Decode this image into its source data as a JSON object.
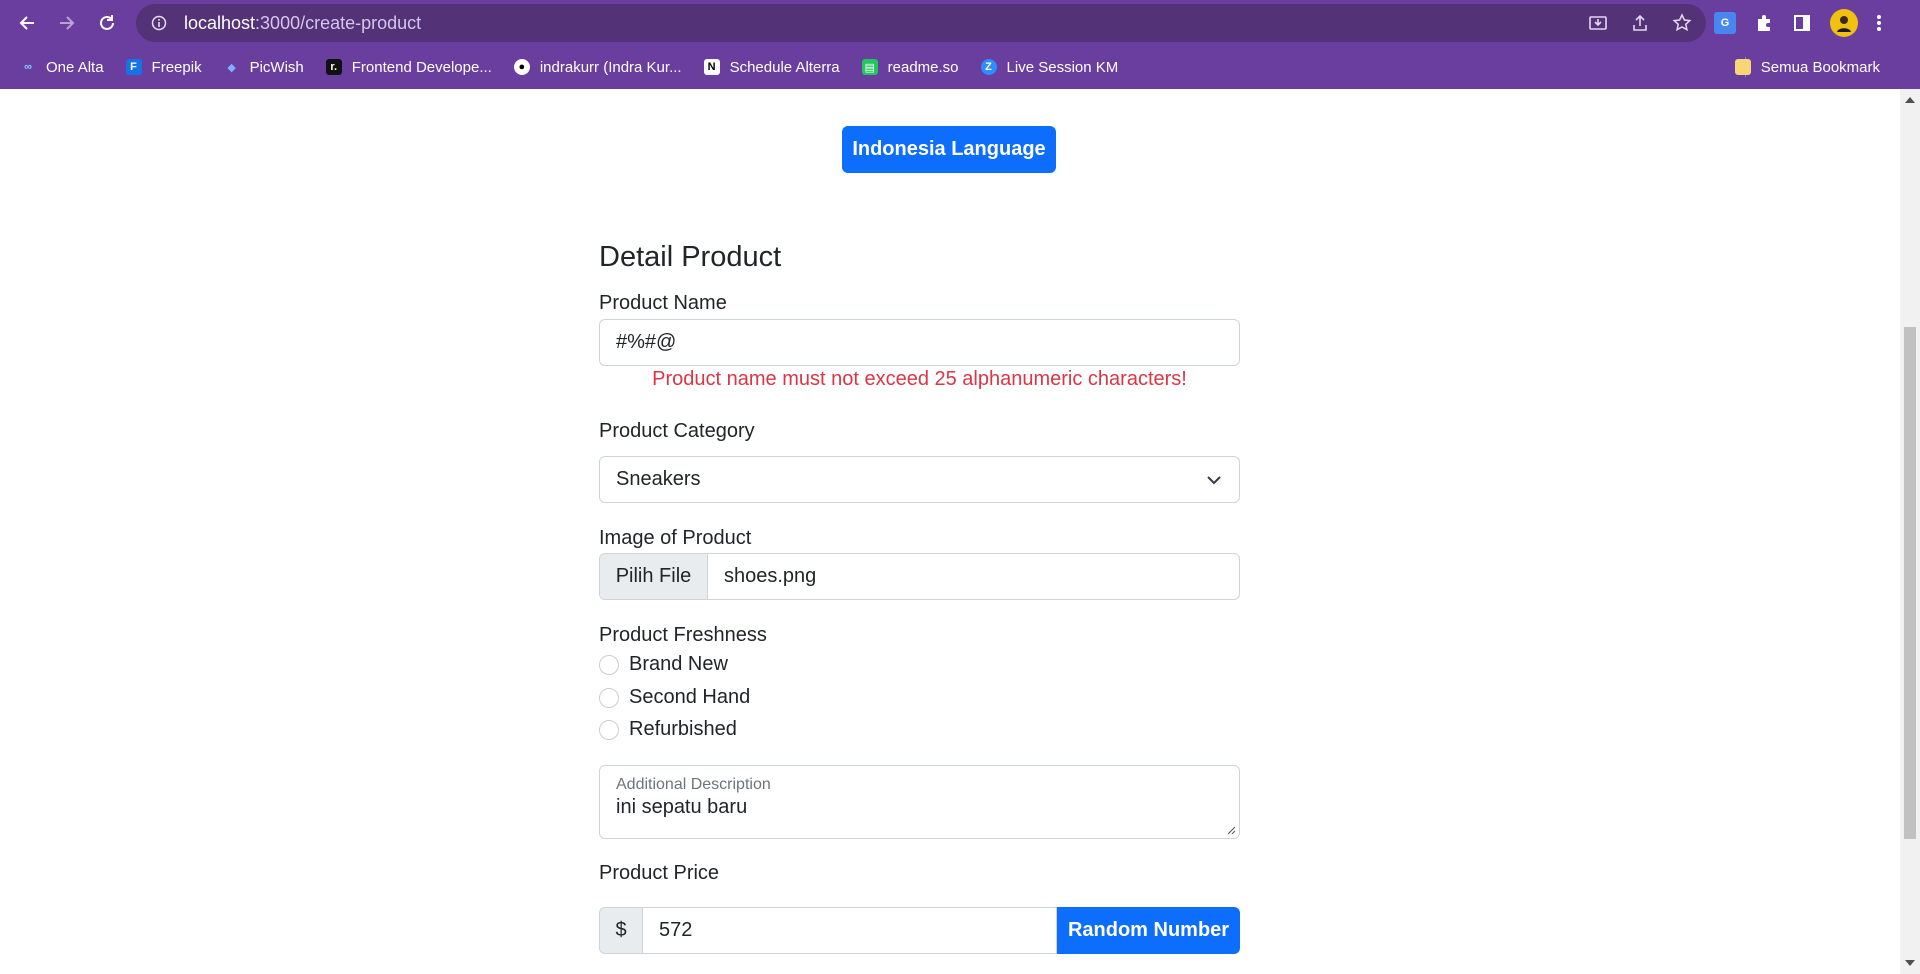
{
  "browser": {
    "url_host": "localhost",
    "url_path": ":3000/create-product",
    "bookmarks": [
      {
        "label": "One Alta",
        "icon": "alta-icon",
        "color": "#2d2d6e"
      },
      {
        "label": "Freepik",
        "icon": "freepik-icon",
        "color": "#1273eb"
      },
      {
        "label": "PicWish",
        "icon": "picwish-icon",
        "color": "#3b82f6"
      },
      {
        "label": "Frontend Develope...",
        "icon": "roadmap-icon",
        "color": "#111111"
      },
      {
        "label": "indrakurr (Indra Kur...",
        "icon": "github-icon",
        "color": "#ffffff"
      },
      {
        "label": "Schedule Alterra",
        "icon": "notion-icon",
        "color": "#ffffff"
      },
      {
        "label": "readme.so",
        "icon": "readme-icon",
        "color": "#22c55e"
      },
      {
        "label": "Live Session KM",
        "icon": "zoom-icon",
        "color": "#2d8cff"
      }
    ],
    "all_bookmarks_label": "Semua Bookmark"
  },
  "page": {
    "language_button": "Indonesia Language",
    "form_title": "Detail Product",
    "product_name": {
      "label": "Product Name",
      "value": "#%#@",
      "error": "Product name must not exceed 25 alphanumeric characters!"
    },
    "product_category": {
      "label": "Product Category",
      "selected": "Sneakers"
    },
    "image": {
      "label": "Image of Product",
      "button": "Pilih File",
      "file_name": "shoes.png"
    },
    "freshness": {
      "label": "Product Freshness",
      "options": [
        "Brand New",
        "Second Hand",
        "Refurbished"
      ]
    },
    "description": {
      "label": "Additional Description",
      "value": "ini sepatu baru"
    },
    "price": {
      "label": "Product Price",
      "prefix": "$",
      "value": "572",
      "random_button": "Random Number"
    }
  },
  "colors": {
    "chrome": "#6a3e9e",
    "primary": "#0d6efd",
    "error": "#dc3545"
  }
}
